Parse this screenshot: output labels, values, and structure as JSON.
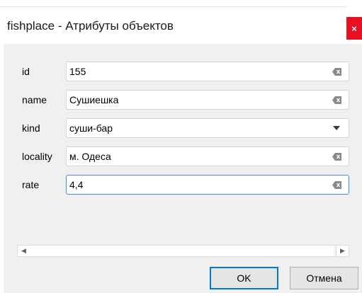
{
  "window": {
    "title": "fishplace - Атрибуты объектов",
    "close_label": "×"
  },
  "fields": [
    {
      "label": "id",
      "value": "155",
      "widget": "text",
      "icon": "clear-icon"
    },
    {
      "label": "name",
      "value": "Сушиешка",
      "widget": "text",
      "icon": "clear-icon"
    },
    {
      "label": "kind",
      "value": "суши-бар",
      "widget": "dropdown",
      "icon": "chevron-down-icon"
    },
    {
      "label": "locality",
      "value": "м. Одеса",
      "widget": "text",
      "icon": "clear-icon"
    },
    {
      "label": "rate",
      "value": "4,4",
      "widget": "text",
      "icon": "clear-icon",
      "focused": true
    }
  ],
  "scrollbar": {
    "left_arrow": "◀",
    "right_arrow": "▶"
  },
  "buttons": {
    "ok_label": "OK",
    "cancel_label": "Отмена"
  },
  "colors": {
    "close_bg": "#e81123",
    "focus_border": "#3d8ee0",
    "default_button_border": "#0078d7"
  }
}
